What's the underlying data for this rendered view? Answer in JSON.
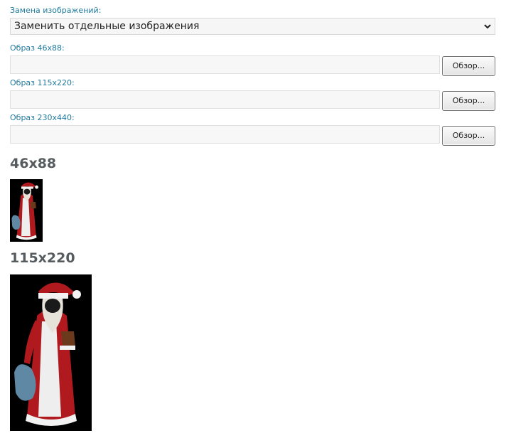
{
  "replace": {
    "label": "Замена изображений:",
    "selected": "Заменить отдельные изображения"
  },
  "fields": [
    {
      "label": "Образ 46x88:",
      "button": "Обзор..."
    },
    {
      "label": "Образ 115x220:",
      "button": "Обзор..."
    },
    {
      "label": "Образ 230x440:",
      "button": "Обзор..."
    }
  ],
  "previews": [
    {
      "title": "46x88"
    },
    {
      "title": "115x220"
    }
  ],
  "colors": {
    "label": "#1f7a9c",
    "heading": "#555b5e",
    "coat": "#b01a1f",
    "fur": "#f2f2f2",
    "bag": "#5f88a4"
  }
}
